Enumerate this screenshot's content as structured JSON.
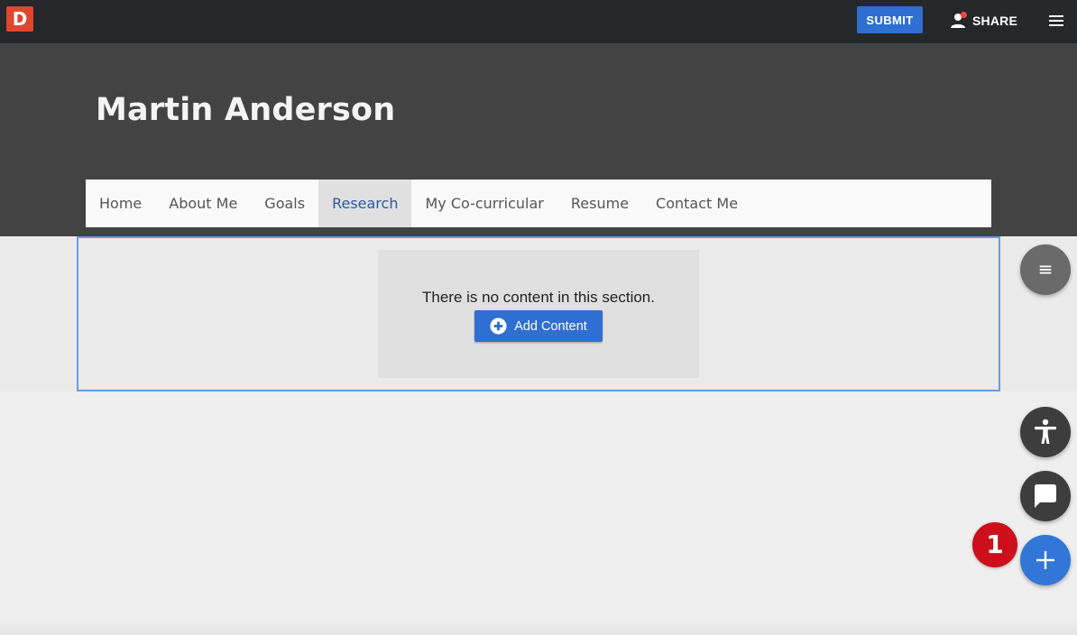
{
  "topbar": {
    "logo_letter": "D",
    "submit_label": "SUBMIT",
    "share_label": "SHARE"
  },
  "hero": {
    "title": "Martin Anderson"
  },
  "nav": {
    "items": [
      {
        "label": "Home"
      },
      {
        "label": "About Me"
      },
      {
        "label": "Goals"
      },
      {
        "label": "Research",
        "active": true
      },
      {
        "label": "My Co-curricular"
      },
      {
        "label": "Resume"
      },
      {
        "label": "Contact Me"
      }
    ]
  },
  "section": {
    "empty_message": "There is no content in this section.",
    "add_content_label": "Add Content"
  },
  "badge": {
    "value": "1"
  },
  "icons": {
    "share": "person-icon",
    "menu": "hamburger-menu-icon",
    "fab_menu": "list-menu-icon",
    "accessibility": "accessibility-icon",
    "chat": "chat-bubble-icon",
    "add": "plus-icon"
  },
  "colors": {
    "accent": "#2f6fd1",
    "logo": "#e0452e",
    "badge": "#cc0f1a"
  }
}
